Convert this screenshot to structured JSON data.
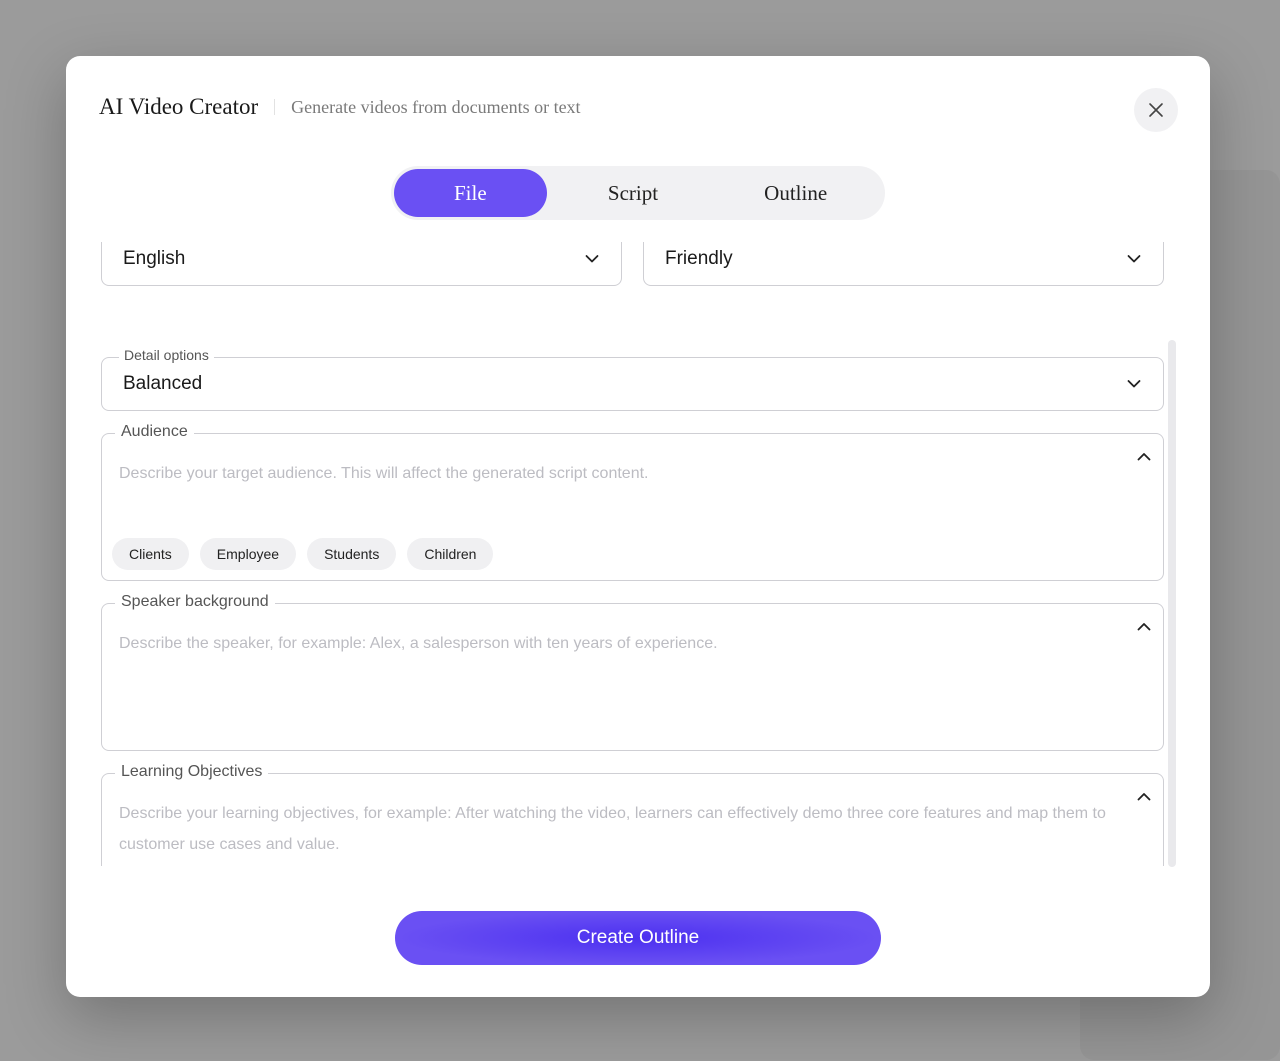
{
  "modal": {
    "title": "AI Video Creator",
    "subtitle": "Generate videos from documents or text"
  },
  "tabs": [
    {
      "label": "File",
      "active": true
    },
    {
      "label": "Script",
      "active": false
    },
    {
      "label": "Outline",
      "active": false
    }
  ],
  "form": {
    "language": {
      "value": "English"
    },
    "tone": {
      "value": "Friendly"
    },
    "detail": {
      "label": "Detail options",
      "value": "Balanced"
    },
    "audience": {
      "label": "Audience",
      "placeholder": "Describe your target audience. This will affect the generated script content.",
      "chips": [
        "Clients",
        "Employee",
        "Students",
        "Children"
      ]
    },
    "speaker": {
      "label": "Speaker background",
      "placeholder": "Describe the speaker, for example: Alex, a salesperson with ten years of experience."
    },
    "objectives": {
      "label": "Learning Objectives",
      "placeholder": "Describe your learning objectives, for example: After watching the video, learners can effectively demo three core features and map them to customer use cases and value."
    }
  },
  "actions": {
    "create_label": "Create Outline"
  },
  "colors": {
    "accent": "#6a50f3",
    "chip_bg": "#f0f0f2",
    "border": "#cfcfd4"
  },
  "icons": {
    "close": "close-icon",
    "dropdown": "chevron-down-icon",
    "collapse": "chevron-up-icon"
  }
}
